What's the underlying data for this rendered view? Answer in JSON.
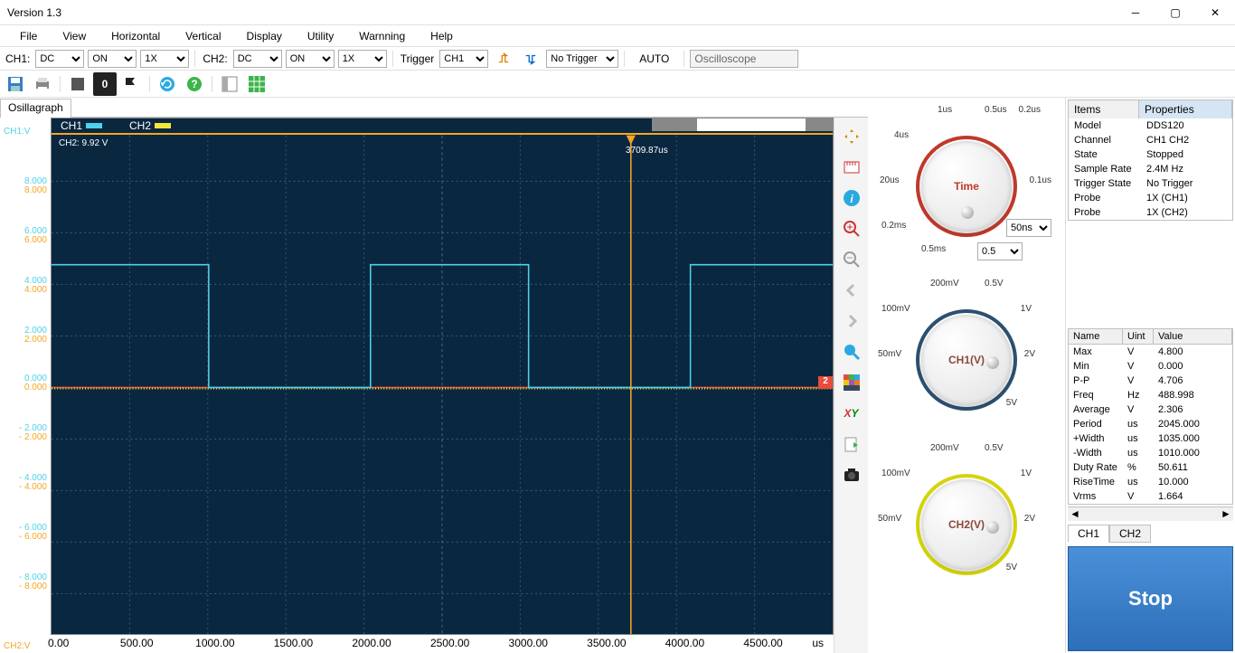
{
  "window": {
    "title": "Version 1.3"
  },
  "menu": {
    "items": [
      "File",
      "View",
      "Horizontal",
      "Vertical",
      "Display",
      "Utility",
      "Warnning",
      "Help"
    ]
  },
  "toolbar1": {
    "ch1_label": "CH1:",
    "ch1_coupling": "DC",
    "ch1_state": "ON",
    "ch1_probe": "1X",
    "ch2_label": "CH2:",
    "ch2_coupling": "DC",
    "ch2_state": "ON",
    "ch2_probe": "1X",
    "trigger_label": "Trigger",
    "trigger_src": "CH1",
    "trigger_mode": "No Trigger",
    "auto_label": "AUTO",
    "device_text": "Oscilloscope"
  },
  "toolbar2": {
    "counter": "0"
  },
  "tabs": {
    "scope": "Osillagraph"
  },
  "scope": {
    "ch1_axis": "CH1:V",
    "ch2_axis": "CH2:V",
    "ch1_badge": "CH1",
    "ch2_badge": "CH2",
    "ch2_meas": "CH2: 9.92 V",
    "cursor_time": "3709.87us",
    "marker2": "2",
    "yticks_ch1": [
      "8.000",
      "6.000",
      "4.000",
      "2.000",
      "0.000",
      "- 2.000",
      "- 4.000",
      "- 6.000",
      "- 8.000"
    ],
    "yticks_ch2": [
      "8.000",
      "6.000",
      "4.000",
      "2.000",
      "0.000",
      "- 2.000",
      "- 4.000",
      "- 6.000",
      "- 8.000"
    ],
    "xticks": [
      "0.00",
      "500.00",
      "1000.00",
      "1500.00",
      "2000.00",
      "2500.00",
      "3000.00",
      "3500.00",
      "4000.00",
      "4500.00"
    ],
    "x_unit": "us",
    "colors": {
      "ch1": "#4dd2e8",
      "ch2": "#f5e63c",
      "cursor": "#f5a623",
      "zero": "#e74c3c",
      "bg": "#0a2740"
    }
  },
  "side_tools": [
    "move-icon",
    "ruler-icon",
    "info-icon",
    "zoom-in-icon",
    "zoom-out-icon",
    "back-icon",
    "forward-icon",
    "search-icon",
    "palette-icon",
    "xy-icon",
    "export-icon",
    "camera-icon"
  ],
  "knobs": {
    "time": {
      "label": "Time",
      "ticks": [
        "1us",
        "0.5us",
        "4us",
        "0.2us",
        "20us",
        "0.1us",
        "0.2ms",
        "0.5ms"
      ],
      "sel1": "50ns",
      "sel2": "0.5",
      "ring": "#c0392b"
    },
    "ch1": {
      "label": "CH1(V)",
      "ticks": [
        "200mV",
        "0.5V",
        "100mV",
        "1V",
        "50mV",
        "2V",
        "5V"
      ],
      "ring": "#2c3e50"
    },
    "ch2": {
      "label": "CH2(V)",
      "ticks": [
        "200mV",
        "0.5V",
        "100mV",
        "1V",
        "50mV",
        "2V",
        "5V"
      ],
      "ring": "#d4d40a"
    }
  },
  "props": {
    "hdr": [
      "Items",
      "Properties"
    ],
    "rows": [
      [
        "Model",
        "DDS120"
      ],
      [
        "Channel",
        "CH1 CH2"
      ],
      [
        "State",
        "Stopped"
      ],
      [
        "Sample Rate",
        "2.4M Hz"
      ],
      [
        "Trigger State",
        "No Trigger"
      ],
      [
        "Probe",
        "1X (CH1)"
      ],
      [
        "Probe",
        "1X (CH2)"
      ]
    ]
  },
  "meas": {
    "hdr": [
      "Name",
      "Uint",
      "Value"
    ],
    "rows": [
      [
        "Max",
        "V",
        "4.800"
      ],
      [
        "Min",
        "V",
        "0.000"
      ],
      [
        "P-P",
        "V",
        "4.706"
      ],
      [
        "Freq",
        "Hz",
        "488.998"
      ],
      [
        "Average",
        "V",
        "2.306"
      ],
      [
        "Period",
        "us",
        "2045.000"
      ],
      [
        "+Width",
        "us",
        "1035.000"
      ],
      [
        "-Width",
        "us",
        "1010.000"
      ],
      [
        "Duty Rate",
        "%",
        "50.611"
      ],
      [
        "RiseTime",
        "us",
        "10.000"
      ],
      [
        "Vrms",
        "V",
        "1.664"
      ]
    ]
  },
  "chtabs": [
    "CH1",
    "CH2"
  ],
  "stop": "Stop",
  "chart_data": {
    "type": "line",
    "title": "Osillagraph",
    "xlabel": "us",
    "ylabel": "V",
    "xlim": [
      0,
      5000
    ],
    "ylim": [
      -10,
      10
    ],
    "series": [
      {
        "name": "CH1",
        "color": "#4dd2e8",
        "x": [
          0,
          1010,
          1010,
          2045,
          2045,
          3055,
          3055,
          4090,
          4090,
          5000
        ],
        "y": [
          4.8,
          4.8,
          0,
          0,
          4.8,
          4.8,
          0,
          0,
          4.8,
          4.8
        ]
      },
      {
        "name": "CH2",
        "color": "#f5e63c",
        "x": [
          0,
          5000
        ],
        "y": [
          0,
          0
        ]
      }
    ],
    "cursor_x": 3709.87
  }
}
